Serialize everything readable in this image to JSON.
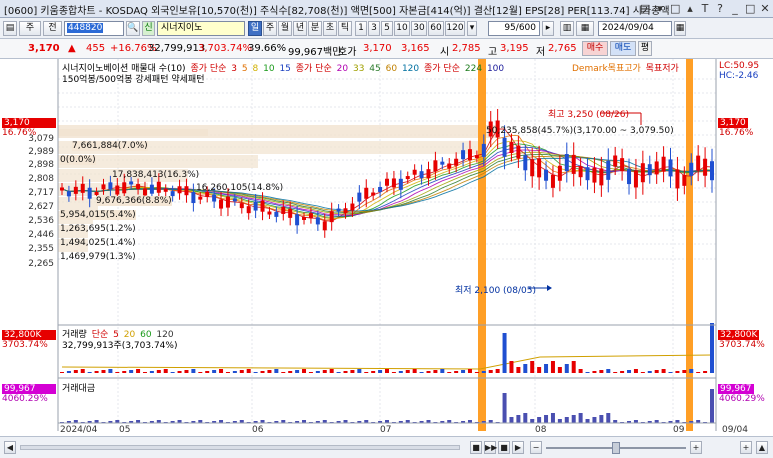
{
  "window": {
    "title": "[0600] 키움종합차트 - KOSDAQ 외국인보유[10,570(천)] 주식수[82,708(천)] 액면[500] 자본금[414(억)] 결산[12월] EPS[28] PER[113.74] 시가총액",
    "controls": [
      "▤",
      "▾",
      "□",
      "▴",
      "T",
      "?",
      "_",
      "□",
      "✕"
    ]
  },
  "toolbar": {
    "item_btn": "주",
    "mode_btn": "전",
    "code_value": "448820",
    "search_icon": "🔍",
    "new_badge": "신",
    "stock_name": "시너지이노",
    "period_buttons": [
      "일",
      "주",
      "월",
      "년",
      "분",
      "초",
      "틱"
    ],
    "interval_buttons": [
      "1",
      "3",
      "5",
      "10",
      "30",
      "60",
      "120"
    ],
    "display_count": "95",
    "display_total": "/600",
    "date": "2024/09/04"
  },
  "quote": {
    "price": "3,170",
    "change_arrow": "▲",
    "change": "455",
    "change_pct": "+16.76%",
    "volume": "32,799,913",
    "volume_ratio": "3,703.74%",
    "turnover": "39.66%",
    "amount": "99,967백만",
    "ask_label": "호가",
    "ask": "3,170",
    "bid": "3,165",
    "open_label": "시",
    "open": "2,785",
    "high_label": "고",
    "high": "3,195",
    "low_label": "저",
    "low": "2,765",
    "buy_btn": "매수",
    "sell_btn": "매도",
    "misc_btn": "평"
  },
  "price_panel": {
    "legend_line1": [
      "시너지이노베이션 매물대 수(10)",
      "종가 단순",
      "3",
      "5",
      "8",
      "10",
      "15",
      "종가 단순",
      "20",
      "33",
      "45",
      "60",
      "120",
      "종가 단순",
      "224",
      "100",
      "Demark목표고가",
      "목표저가"
    ],
    "legend_line2": "150억봉/500억봉 강세패턴  약세패턴",
    "right_tags": {
      "lc": "LC:50.95",
      "hc": "HC:-2.46",
      "price": "3,170",
      "pct": "16.76%"
    },
    "left_current": {
      "price": "3,170",
      "pct": "16.76%"
    },
    "y_ticks": [
      "3,079",
      "2,989",
      "2,898",
      "2,808",
      "2,717",
      "2,627",
      "2,536",
      "2,446",
      "2,355",
      "2,265"
    ],
    "volume_profile_labels": [
      "7,661,884(7.0%)",
      "0(0.0%)",
      "17,838,413(16.3%)",
      "16,260,105(14.8%)",
      "9,676,366(8.8%)",
      "5,954,015(5.4%)",
      "1,263,695(1.2%)",
      "1,494,025(1.4%)",
      "1,469,979(1.3%)"
    ],
    "big_profile_label": "50,235,858(45.7%)(3,170.00 ~ 3,079.50)",
    "high_annot": "최고 3,250 (08/26)",
    "low_annot": "최저 2,100 (08/05)"
  },
  "volume_panel": {
    "legend": [
      "거래량",
      "단순",
      "5",
      "20",
      "60",
      "120"
    ],
    "info": "32,799,913주(3,703.74%)",
    "left_tag": "32,800K",
    "left_pct": "3703.74%",
    "right_tag": "32,800K",
    "right_pct": "3703.74%"
  },
  "amount_panel": {
    "legend": "거래대금",
    "left_tag": "99,967",
    "left_pct": "4060.29%",
    "right_tag": "99,967",
    "right_pct": "4060.29%"
  },
  "x_axis": [
    "2024/04",
    "05",
    "06",
    "07",
    "08",
    "09",
    "09/04"
  ],
  "navigator": [
    "◀",
    "■",
    "▶▶",
    "■",
    "▶",
    "−",
    "+",
    "+",
    "▲"
  ],
  "colors": {
    "up": "#e60000",
    "down": "#1f4fd1",
    "highlight_bar": "#ff9a1a",
    "magenta": "#d400d4"
  }
}
